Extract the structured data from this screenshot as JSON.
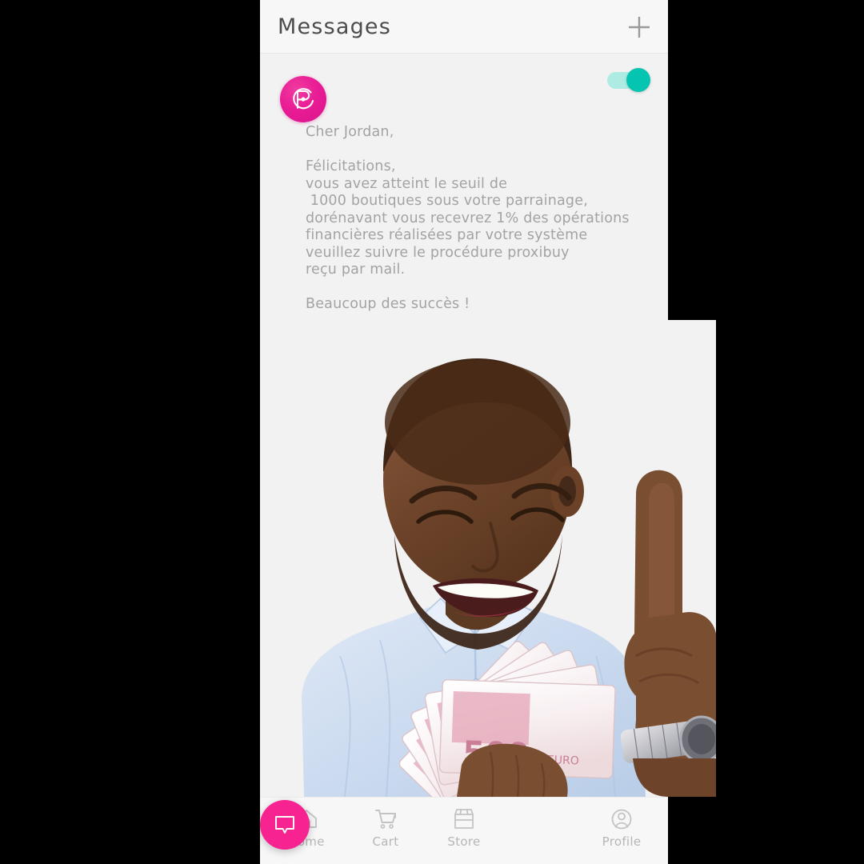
{
  "app": {
    "screen_title": "Messages",
    "background_color": "#f2f2f2",
    "frame_color": "#000000"
  },
  "header": {
    "title": "Messages",
    "add_icon": "plus-icon",
    "background_color": "#f7f7f7"
  },
  "message": {
    "sender_avatar_icon": "proxibuy-logo-icon",
    "sender_avatar_color": "#ea1e96",
    "read_toggle": {
      "state": "on",
      "track_color": "#aeece3",
      "knob_color": "#06c5b0"
    },
    "body": "Cher Jordan,\n\nFélicitations,\nvous avez atteint le seuil de\n 1000 boutiques sous votre parrainage,\ndorénavant vous recevrez 1% des opérations\nfinancières réalisées par votre système\nveuillez suivre le procédure proxibuy\nreçu par mail.\n\nBeaucoup des succès !",
    "text_color": "#a3a3a3",
    "lines": [
      "Cher Jordan,",
      "",
      "Félicitations,",
      "vous avez atteint le seuil de",
      " 1000 boutiques sous votre parrainage,",
      "dorénavant vous recevrez 1% des opérations",
      "financières réalisées par votre système",
      "veuillez suivre le procédure proxibuy",
      "reçu par mail.",
      "",
      "Beaucoup des succès !"
    ],
    "attachment": {
      "type": "photo",
      "description": "Smiling man in light blue shirt holding a fan of 500 euro banknotes with index finger raised",
      "banknote_denomination": "500",
      "banknote_currency": "EURO"
    }
  },
  "bottom_nav": {
    "background_color": "#f7f7f7",
    "items": [
      {
        "label": "Home",
        "icon": "home-icon",
        "active": false
      },
      {
        "label": "Cart",
        "icon": "cart-icon",
        "active": false
      },
      {
        "label": "Store",
        "icon": "store-icon",
        "active": false
      },
      {
        "label": "Profile",
        "icon": "profile-icon",
        "active": false
      }
    ],
    "fab": {
      "icon": "chat-bubble-icon",
      "color": "#f72390"
    }
  }
}
